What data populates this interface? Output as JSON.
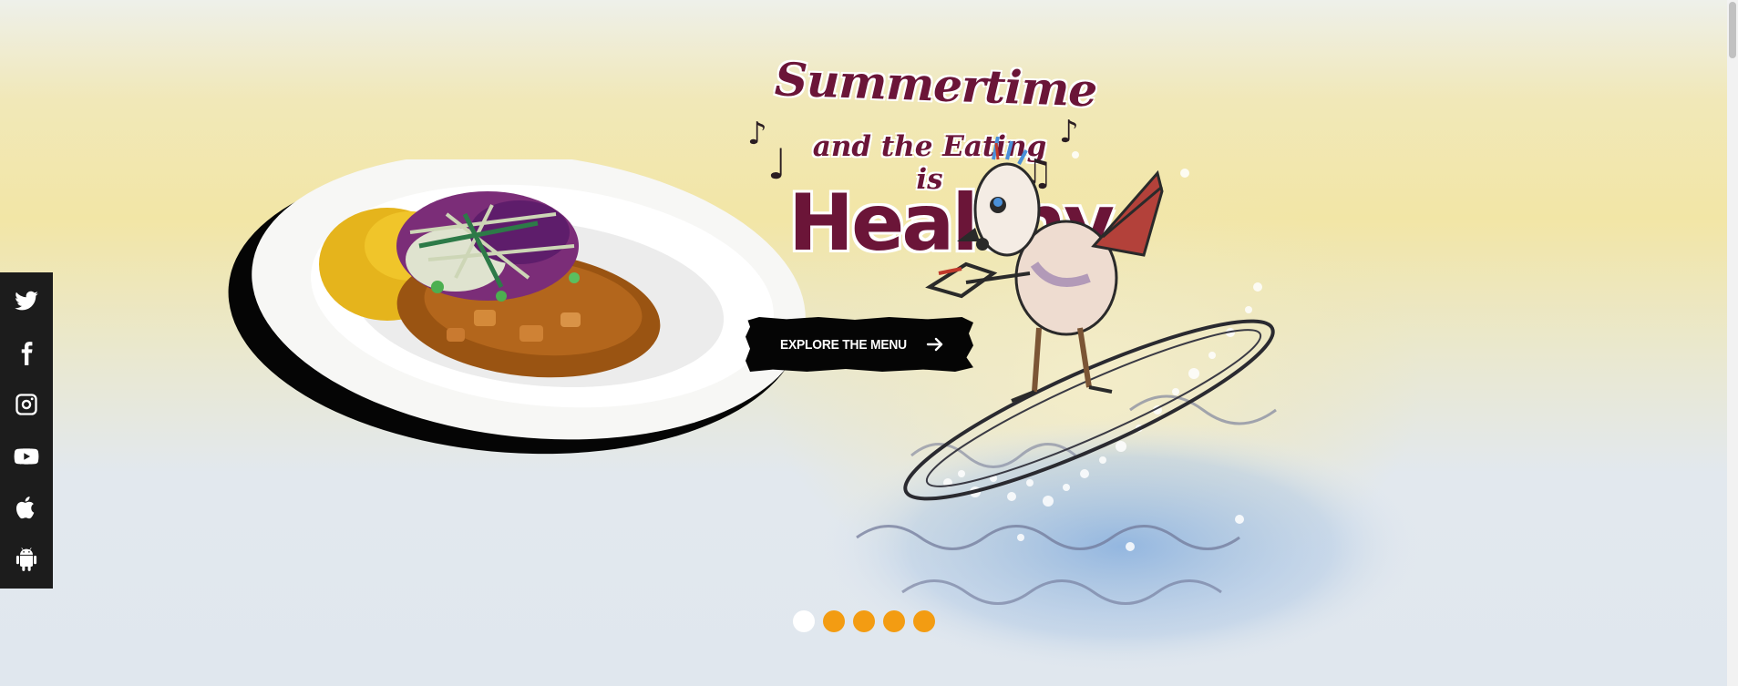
{
  "hero": {
    "headline_line1": "Summertime",
    "headline_line2": "and the Eating is",
    "headline_line3": "Healthy",
    "cta_label": "EXPLORE THE MENU"
  },
  "social": {
    "items": [
      {
        "icon": "twitter-icon"
      },
      {
        "icon": "facebook-icon"
      },
      {
        "icon": "instagram-icon"
      },
      {
        "icon": "youtube-icon"
      },
      {
        "icon": "apple-icon"
      },
      {
        "icon": "android-icon"
      }
    ]
  },
  "carousel": {
    "slide_count": 5,
    "active_index": 0
  },
  "colors": {
    "headline": "#6b1538",
    "dot_inactive": "#f39c12",
    "dot_active": "#ffffff",
    "sidebar_bg": "#1c1c1c"
  }
}
